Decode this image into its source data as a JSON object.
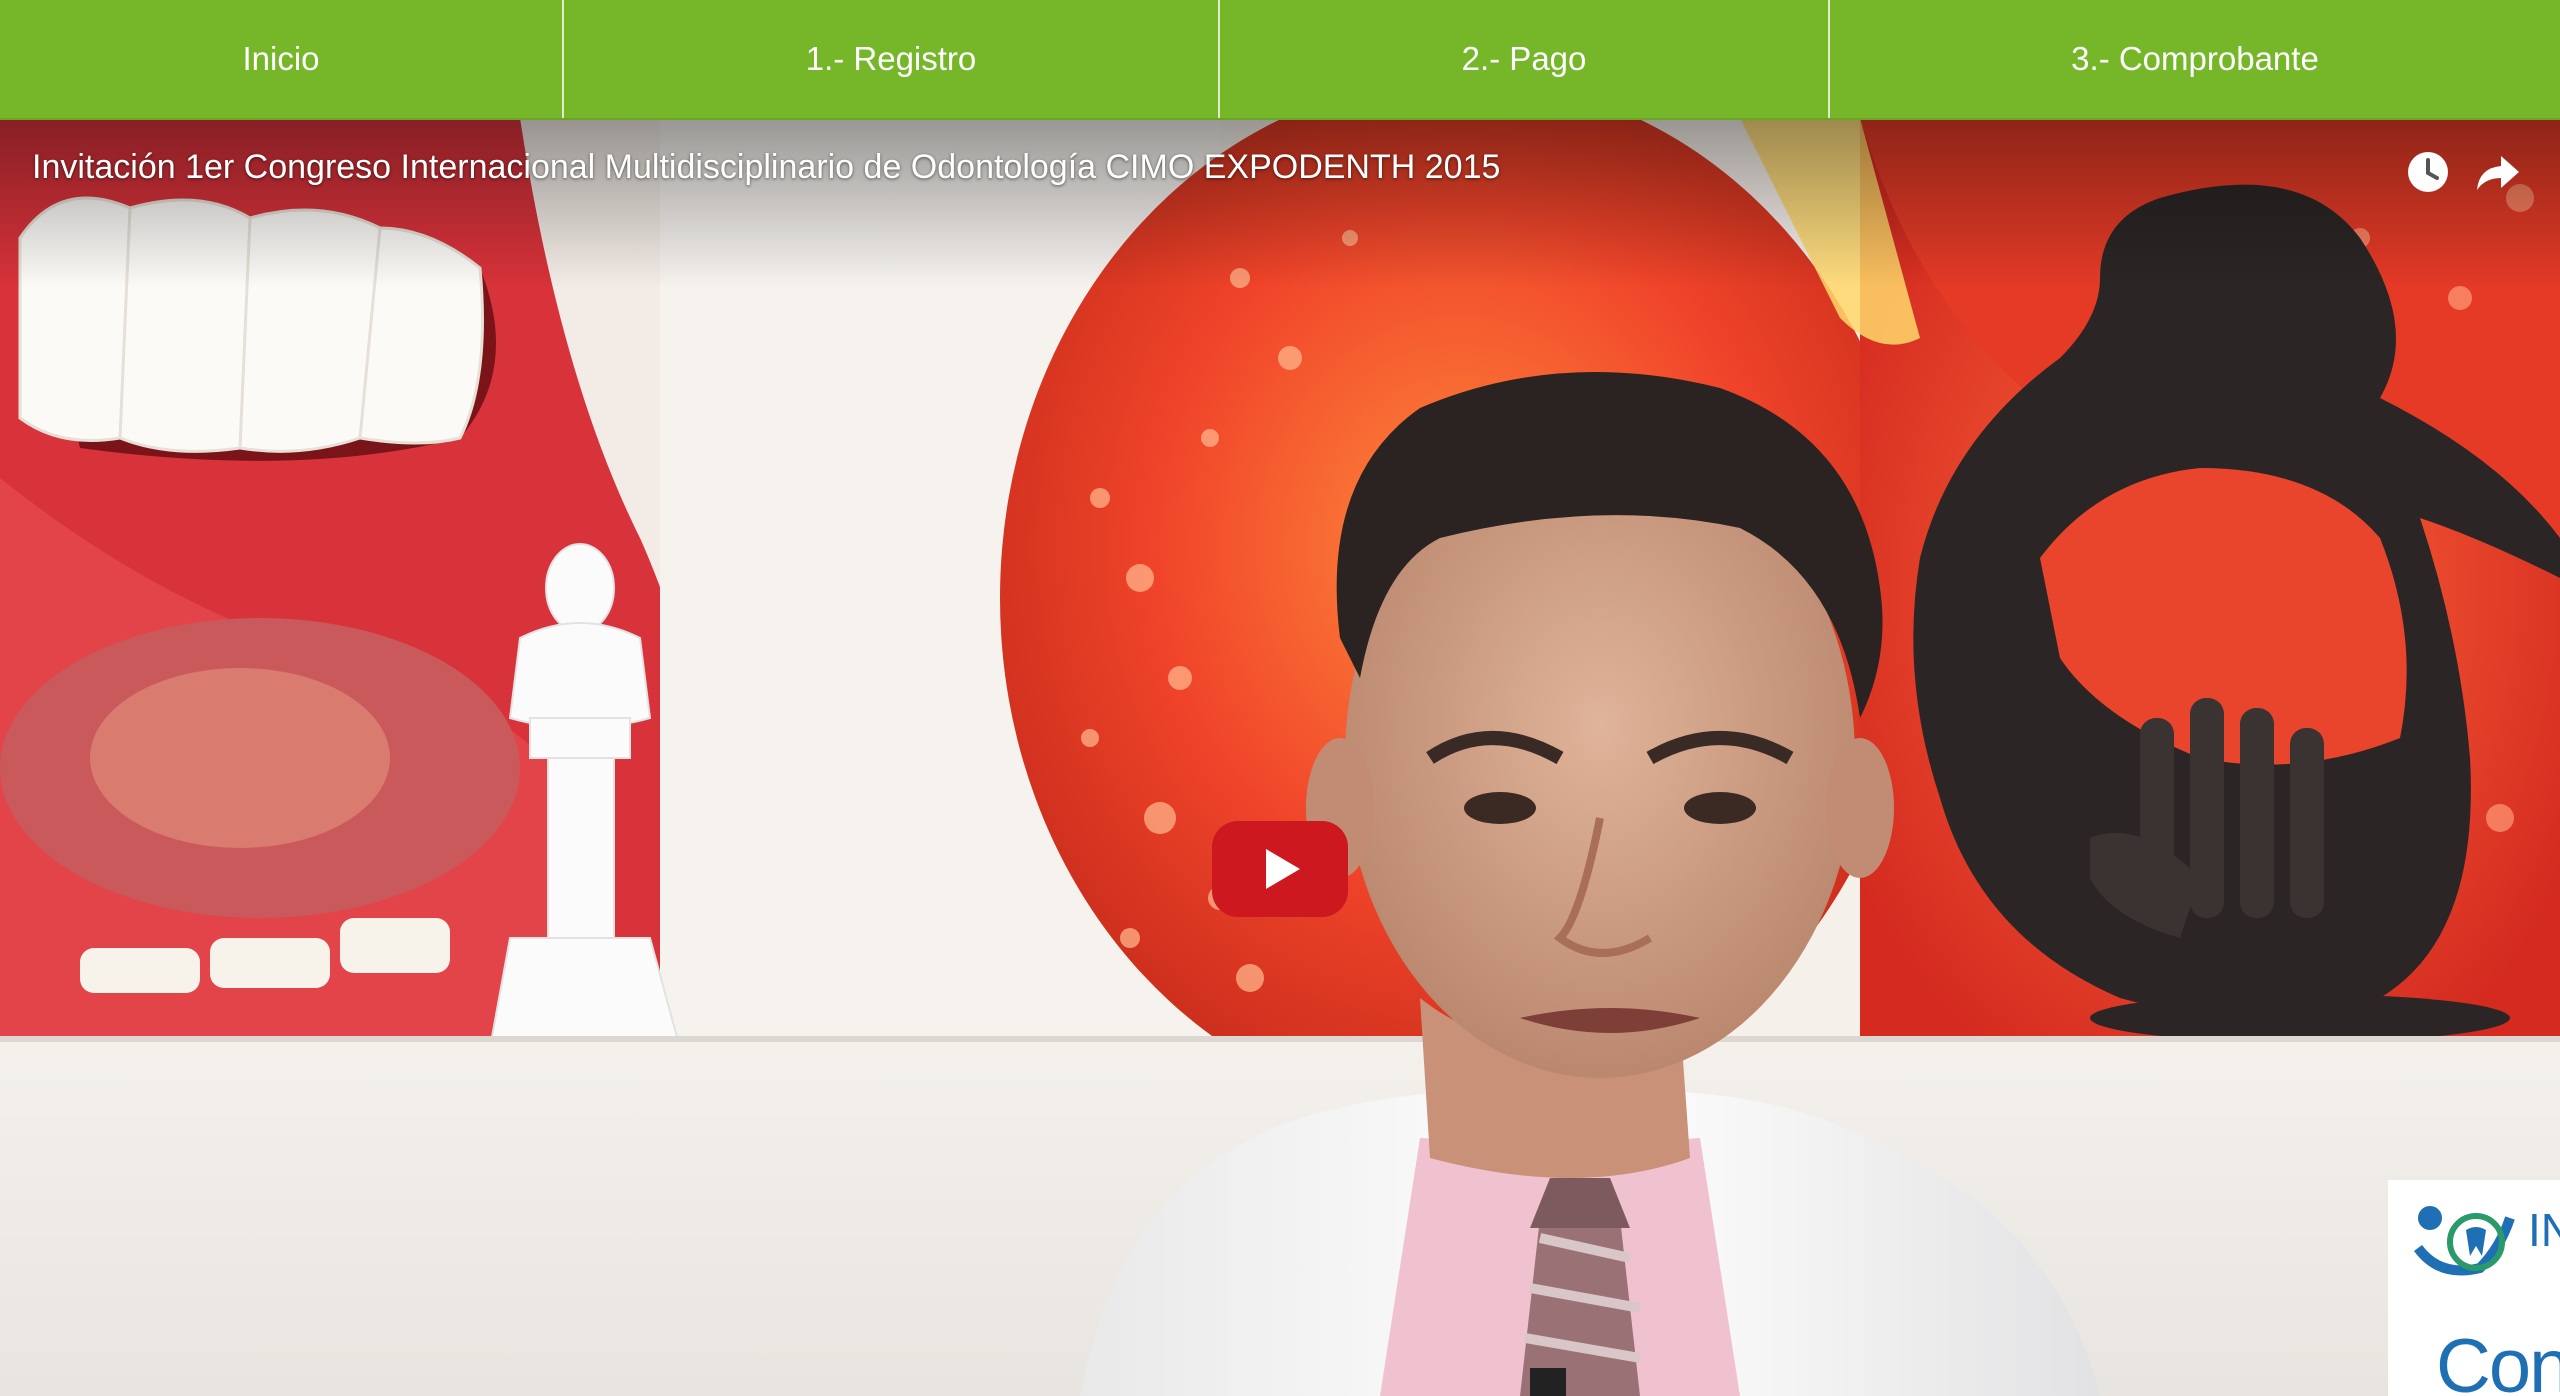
{
  "nav": {
    "items": [
      {
        "label": "Inicio"
      },
      {
        "label": "1.- Registro"
      },
      {
        "label": "2.- Pago"
      },
      {
        "label": "3.- Comprobante"
      }
    ]
  },
  "video": {
    "title": "Invitación 1er Congreso Internacional Multidisciplinario de Odontología CIMO EXPODENTH 2015",
    "controls": {
      "watch_later_icon": "clock-icon",
      "share_icon": "share-arrow-icon",
      "play_icon": "youtube-play-icon"
    },
    "logo_partial": {
      "top": "IN",
      "bottom": "Con"
    }
  },
  "colors": {
    "nav_green": "#76b72a",
    "youtube_red": "#cc181e"
  }
}
